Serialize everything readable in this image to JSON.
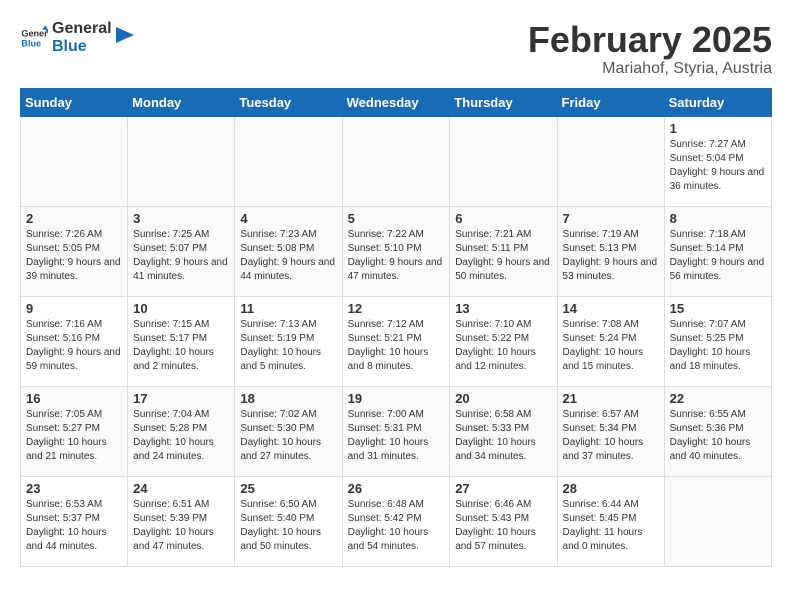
{
  "logo": {
    "line1": "General",
    "line2": "Blue"
  },
  "title": "February 2025",
  "location": "Mariahof, Styria, Austria",
  "days_of_week": [
    "Sunday",
    "Monday",
    "Tuesday",
    "Wednesday",
    "Thursday",
    "Friday",
    "Saturday"
  ],
  "weeks": [
    [
      {
        "num": "",
        "detail": ""
      },
      {
        "num": "",
        "detail": ""
      },
      {
        "num": "",
        "detail": ""
      },
      {
        "num": "",
        "detail": ""
      },
      {
        "num": "",
        "detail": ""
      },
      {
        "num": "",
        "detail": ""
      },
      {
        "num": "1",
        "detail": "Sunrise: 7:27 AM\nSunset: 5:04 PM\nDaylight: 9 hours and 36 minutes."
      }
    ],
    [
      {
        "num": "2",
        "detail": "Sunrise: 7:26 AM\nSunset: 5:05 PM\nDaylight: 9 hours and 39 minutes."
      },
      {
        "num": "3",
        "detail": "Sunrise: 7:25 AM\nSunset: 5:07 PM\nDaylight: 9 hours and 41 minutes."
      },
      {
        "num": "4",
        "detail": "Sunrise: 7:23 AM\nSunset: 5:08 PM\nDaylight: 9 hours and 44 minutes."
      },
      {
        "num": "5",
        "detail": "Sunrise: 7:22 AM\nSunset: 5:10 PM\nDaylight: 9 hours and 47 minutes."
      },
      {
        "num": "6",
        "detail": "Sunrise: 7:21 AM\nSunset: 5:11 PM\nDaylight: 9 hours and 50 minutes."
      },
      {
        "num": "7",
        "detail": "Sunrise: 7:19 AM\nSunset: 5:13 PM\nDaylight: 9 hours and 53 minutes."
      },
      {
        "num": "8",
        "detail": "Sunrise: 7:18 AM\nSunset: 5:14 PM\nDaylight: 9 hours and 56 minutes."
      }
    ],
    [
      {
        "num": "9",
        "detail": "Sunrise: 7:16 AM\nSunset: 5:16 PM\nDaylight: 9 hours and 59 minutes."
      },
      {
        "num": "10",
        "detail": "Sunrise: 7:15 AM\nSunset: 5:17 PM\nDaylight: 10 hours and 2 minutes."
      },
      {
        "num": "11",
        "detail": "Sunrise: 7:13 AM\nSunset: 5:19 PM\nDaylight: 10 hours and 5 minutes."
      },
      {
        "num": "12",
        "detail": "Sunrise: 7:12 AM\nSunset: 5:21 PM\nDaylight: 10 hours and 8 minutes."
      },
      {
        "num": "13",
        "detail": "Sunrise: 7:10 AM\nSunset: 5:22 PM\nDaylight: 10 hours and 12 minutes."
      },
      {
        "num": "14",
        "detail": "Sunrise: 7:08 AM\nSunset: 5:24 PM\nDaylight: 10 hours and 15 minutes."
      },
      {
        "num": "15",
        "detail": "Sunrise: 7:07 AM\nSunset: 5:25 PM\nDaylight: 10 hours and 18 minutes."
      }
    ],
    [
      {
        "num": "16",
        "detail": "Sunrise: 7:05 AM\nSunset: 5:27 PM\nDaylight: 10 hours and 21 minutes."
      },
      {
        "num": "17",
        "detail": "Sunrise: 7:04 AM\nSunset: 5:28 PM\nDaylight: 10 hours and 24 minutes."
      },
      {
        "num": "18",
        "detail": "Sunrise: 7:02 AM\nSunset: 5:30 PM\nDaylight: 10 hours and 27 minutes."
      },
      {
        "num": "19",
        "detail": "Sunrise: 7:00 AM\nSunset: 5:31 PM\nDaylight: 10 hours and 31 minutes."
      },
      {
        "num": "20",
        "detail": "Sunrise: 6:58 AM\nSunset: 5:33 PM\nDaylight: 10 hours and 34 minutes."
      },
      {
        "num": "21",
        "detail": "Sunrise: 6:57 AM\nSunset: 5:34 PM\nDaylight: 10 hours and 37 minutes."
      },
      {
        "num": "22",
        "detail": "Sunrise: 6:55 AM\nSunset: 5:36 PM\nDaylight: 10 hours and 40 minutes."
      }
    ],
    [
      {
        "num": "23",
        "detail": "Sunrise: 6:53 AM\nSunset: 5:37 PM\nDaylight: 10 hours and 44 minutes."
      },
      {
        "num": "24",
        "detail": "Sunrise: 6:51 AM\nSunset: 5:39 PM\nDaylight: 10 hours and 47 minutes."
      },
      {
        "num": "25",
        "detail": "Sunrise: 6:50 AM\nSunset: 5:40 PM\nDaylight: 10 hours and 50 minutes."
      },
      {
        "num": "26",
        "detail": "Sunrise: 6:48 AM\nSunset: 5:42 PM\nDaylight: 10 hours and 54 minutes."
      },
      {
        "num": "27",
        "detail": "Sunrise: 6:46 AM\nSunset: 5:43 PM\nDaylight: 10 hours and 57 minutes."
      },
      {
        "num": "28",
        "detail": "Sunrise: 6:44 AM\nSunset: 5:45 PM\nDaylight: 11 hours and 0 minutes."
      },
      {
        "num": "",
        "detail": ""
      }
    ]
  ]
}
